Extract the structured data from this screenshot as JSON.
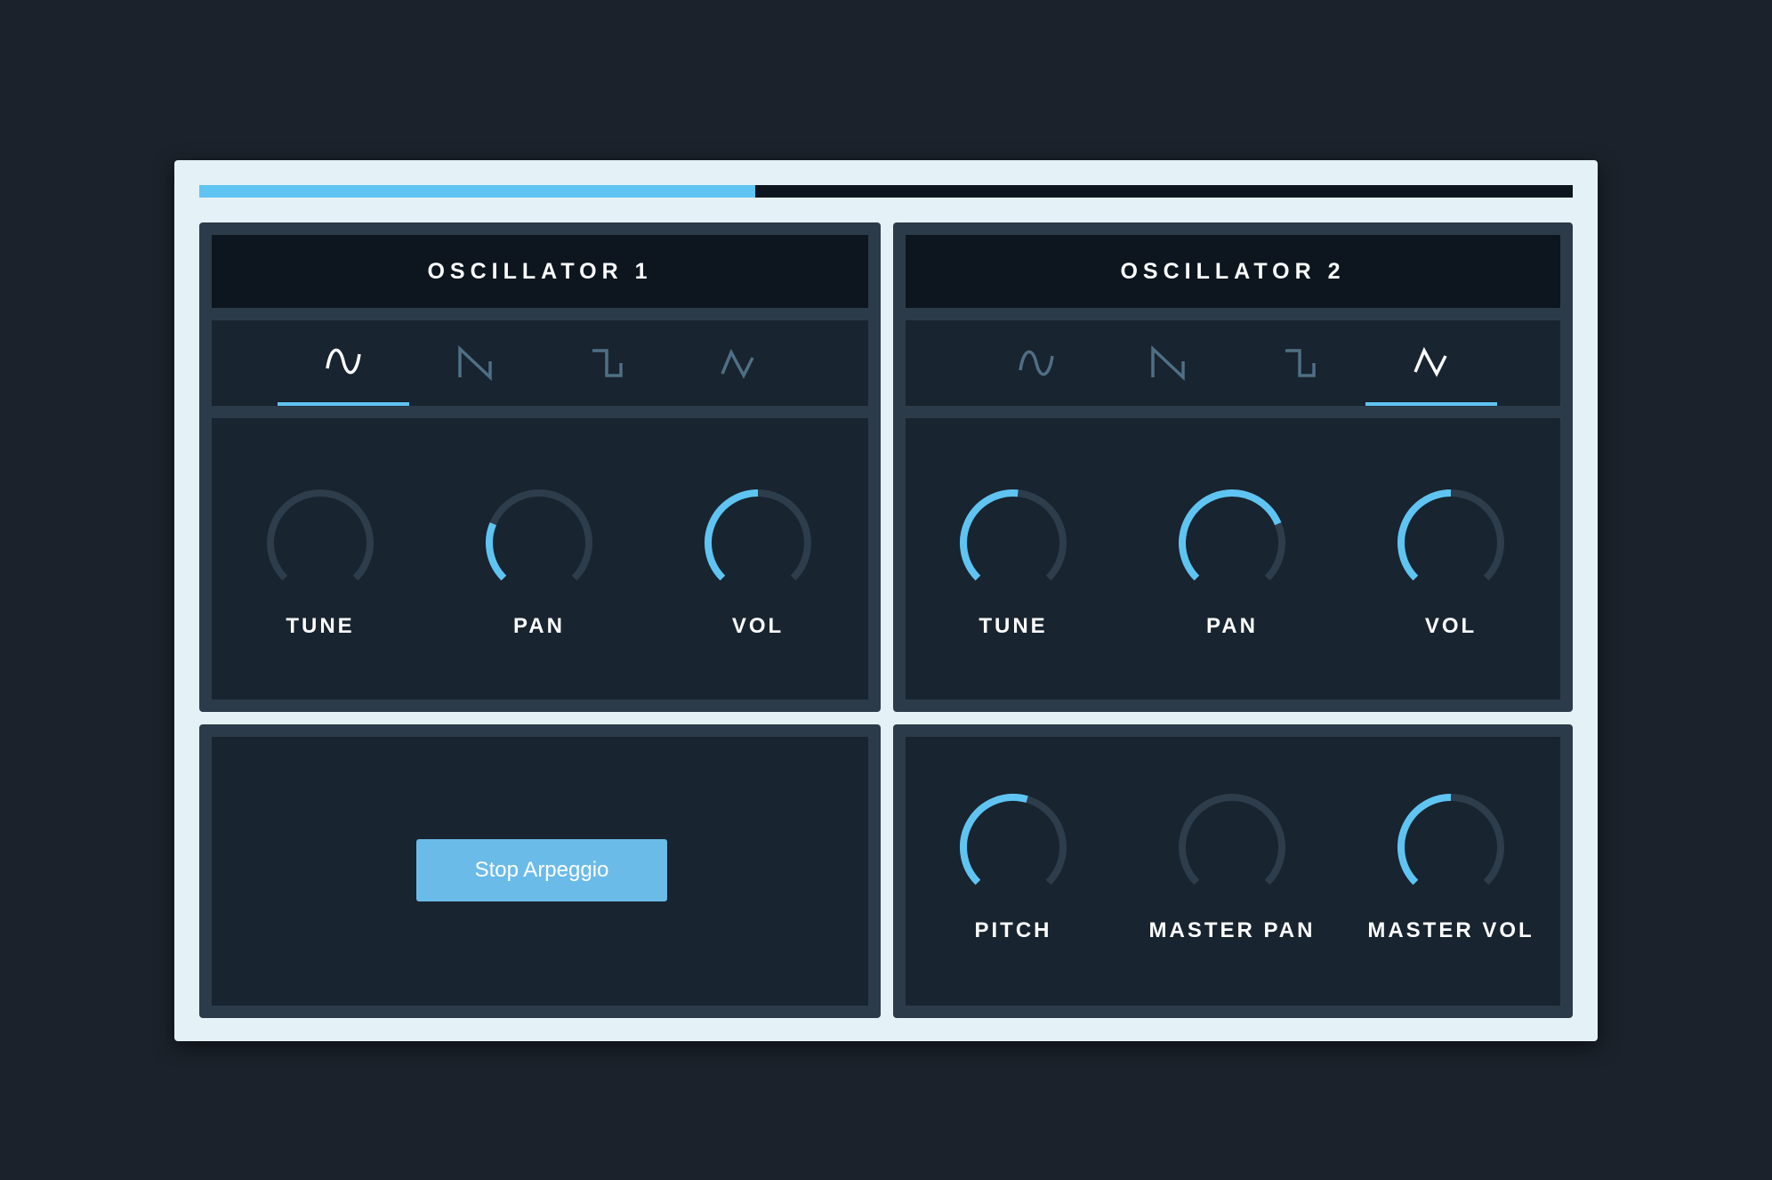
{
  "progress": {
    "value": 0.405
  },
  "colors": {
    "accent": "#5fc4f2",
    "track": "#2e3d4b",
    "wave_active": "#ffffff",
    "wave_inactive": "#4f6f86"
  },
  "oscillators": [
    {
      "title": "OSCILLATOR 1",
      "waveforms": [
        {
          "name": "sine",
          "icon": "sine-wave-icon",
          "active": true
        },
        {
          "name": "sawtooth",
          "icon": "sawtooth-wave-icon",
          "active": false
        },
        {
          "name": "square",
          "icon": "square-wave-icon",
          "active": false
        },
        {
          "name": "triangle",
          "icon": "triangle-wave-icon",
          "active": false
        }
      ],
      "knobs": [
        {
          "label": "TUNE",
          "value": 0.0
        },
        {
          "label": "PAN",
          "value": 0.25
        },
        {
          "label": "VOL",
          "value": 0.5
        }
      ]
    },
    {
      "title": "OSCILLATOR 2",
      "waveforms": [
        {
          "name": "sine",
          "icon": "sine-wave-icon",
          "active": false
        },
        {
          "name": "sawtooth",
          "icon": "sawtooth-wave-icon",
          "active": false
        },
        {
          "name": "square",
          "icon": "square-wave-icon",
          "active": false
        },
        {
          "name": "triangle",
          "icon": "triangle-wave-icon",
          "active": true
        }
      ],
      "knobs": [
        {
          "label": "TUNE",
          "value": 0.52
        },
        {
          "label": "PAN",
          "value": 0.75
        },
        {
          "label": "VOL",
          "value": 0.5
        }
      ]
    }
  ],
  "arpeggio": {
    "button_label": "Stop Arpeggio"
  },
  "master": {
    "knobs": [
      {
        "label": "PITCH",
        "value": 0.56
      },
      {
        "label": "MASTER PAN",
        "value": 0.0
      },
      {
        "label": "MASTER VOL",
        "value": 0.5
      }
    ]
  }
}
